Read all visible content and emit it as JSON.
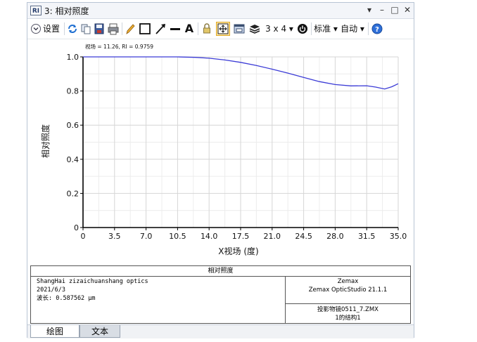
{
  "window": {
    "icon_label": "RI",
    "title": "3: 相对照度",
    "controls": [
      "▾",
      "–",
      "□",
      "✕"
    ]
  },
  "toolbar": {
    "settings_label": "设置",
    "layout_label": "3 x 4 ▾",
    "standard_label": "标准 ▾",
    "auto_label": "自动 ▾"
  },
  "chart_data": {
    "type": "line",
    "annotation": "视场 = 11.26, RI = 0.9759",
    "xlabel": "X视场 (度)",
    "ylabel": "相对照度",
    "xlim": [
      0,
      35
    ],
    "ylim": [
      0,
      1.0
    ],
    "x_ticks": [
      "0",
      "3.5",
      "7.0",
      "10.5",
      "14.0",
      "17.5",
      "21.0",
      "24.5",
      "28.0",
      "31.5",
      "35.0"
    ],
    "y_ticks": [
      "0",
      "0.2",
      "0.4",
      "0.6",
      "0.8",
      "1.0"
    ],
    "grid": true,
    "series": [
      {
        "color": "#3b3bd6",
        "x": [
          0,
          3.5,
          7.0,
          10.5,
          12.5,
          14.0,
          15.75,
          17.5,
          19.25,
          21.0,
          22.75,
          24.5,
          26.25,
          28.0,
          29.75,
          31.5,
          32.5,
          33.5,
          34.3,
          35.0
        ],
        "y": [
          1.0,
          1.0,
          1.0,
          1.0,
          0.997,
          0.992,
          0.982,
          0.968,
          0.95,
          0.928,
          0.905,
          0.88,
          0.855,
          0.838,
          0.83,
          0.831,
          0.823,
          0.812,
          0.825,
          0.843
        ]
      }
    ]
  },
  "footer": {
    "title": "相对照度",
    "left_lines": [
      "ShangHai zizaichuanshang optics",
      "2021/6/3",
      "波长: 0.587562 µm"
    ],
    "right_top_lines": [
      "Zemax",
      "Zemax OpticStudio 21.1.1"
    ],
    "right_bottom_lines": [
      "投影物镜0511_7.ZMX",
      "1的结构1"
    ]
  },
  "tabs": [
    "绘图",
    "文本"
  ]
}
